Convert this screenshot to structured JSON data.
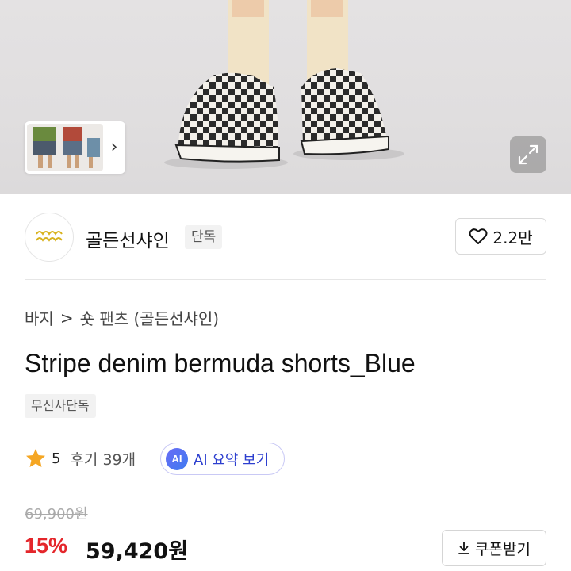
{
  "gallery": {
    "next_arrow": "›",
    "expand_icon": "expand-icon"
  },
  "brand": {
    "name": "골든선샤인",
    "tag": "단독",
    "logo_icon": "brand-logo-icon"
  },
  "like": {
    "count": "2.2만",
    "icon": "heart-icon"
  },
  "breadcrumb": {
    "category": "바지",
    "separator": ">",
    "subcategory": "숏 팬츠 (골든선샤인)"
  },
  "product": {
    "title": "Stripe denim bermuda shorts_Blue",
    "exclusive_badge": "무신사단독"
  },
  "rating": {
    "score": "5",
    "review_label": "후기 39개",
    "star_color": "#f5a623",
    "ai_badge": "AI",
    "ai_summary_label": "AI 요약 보기"
  },
  "price": {
    "original": "69,900원",
    "discount": "15%",
    "final": "59,420원",
    "discount_color": "#e4262b"
  },
  "coupon": {
    "label": "쿠폰받기",
    "icon": "download-icon"
  }
}
